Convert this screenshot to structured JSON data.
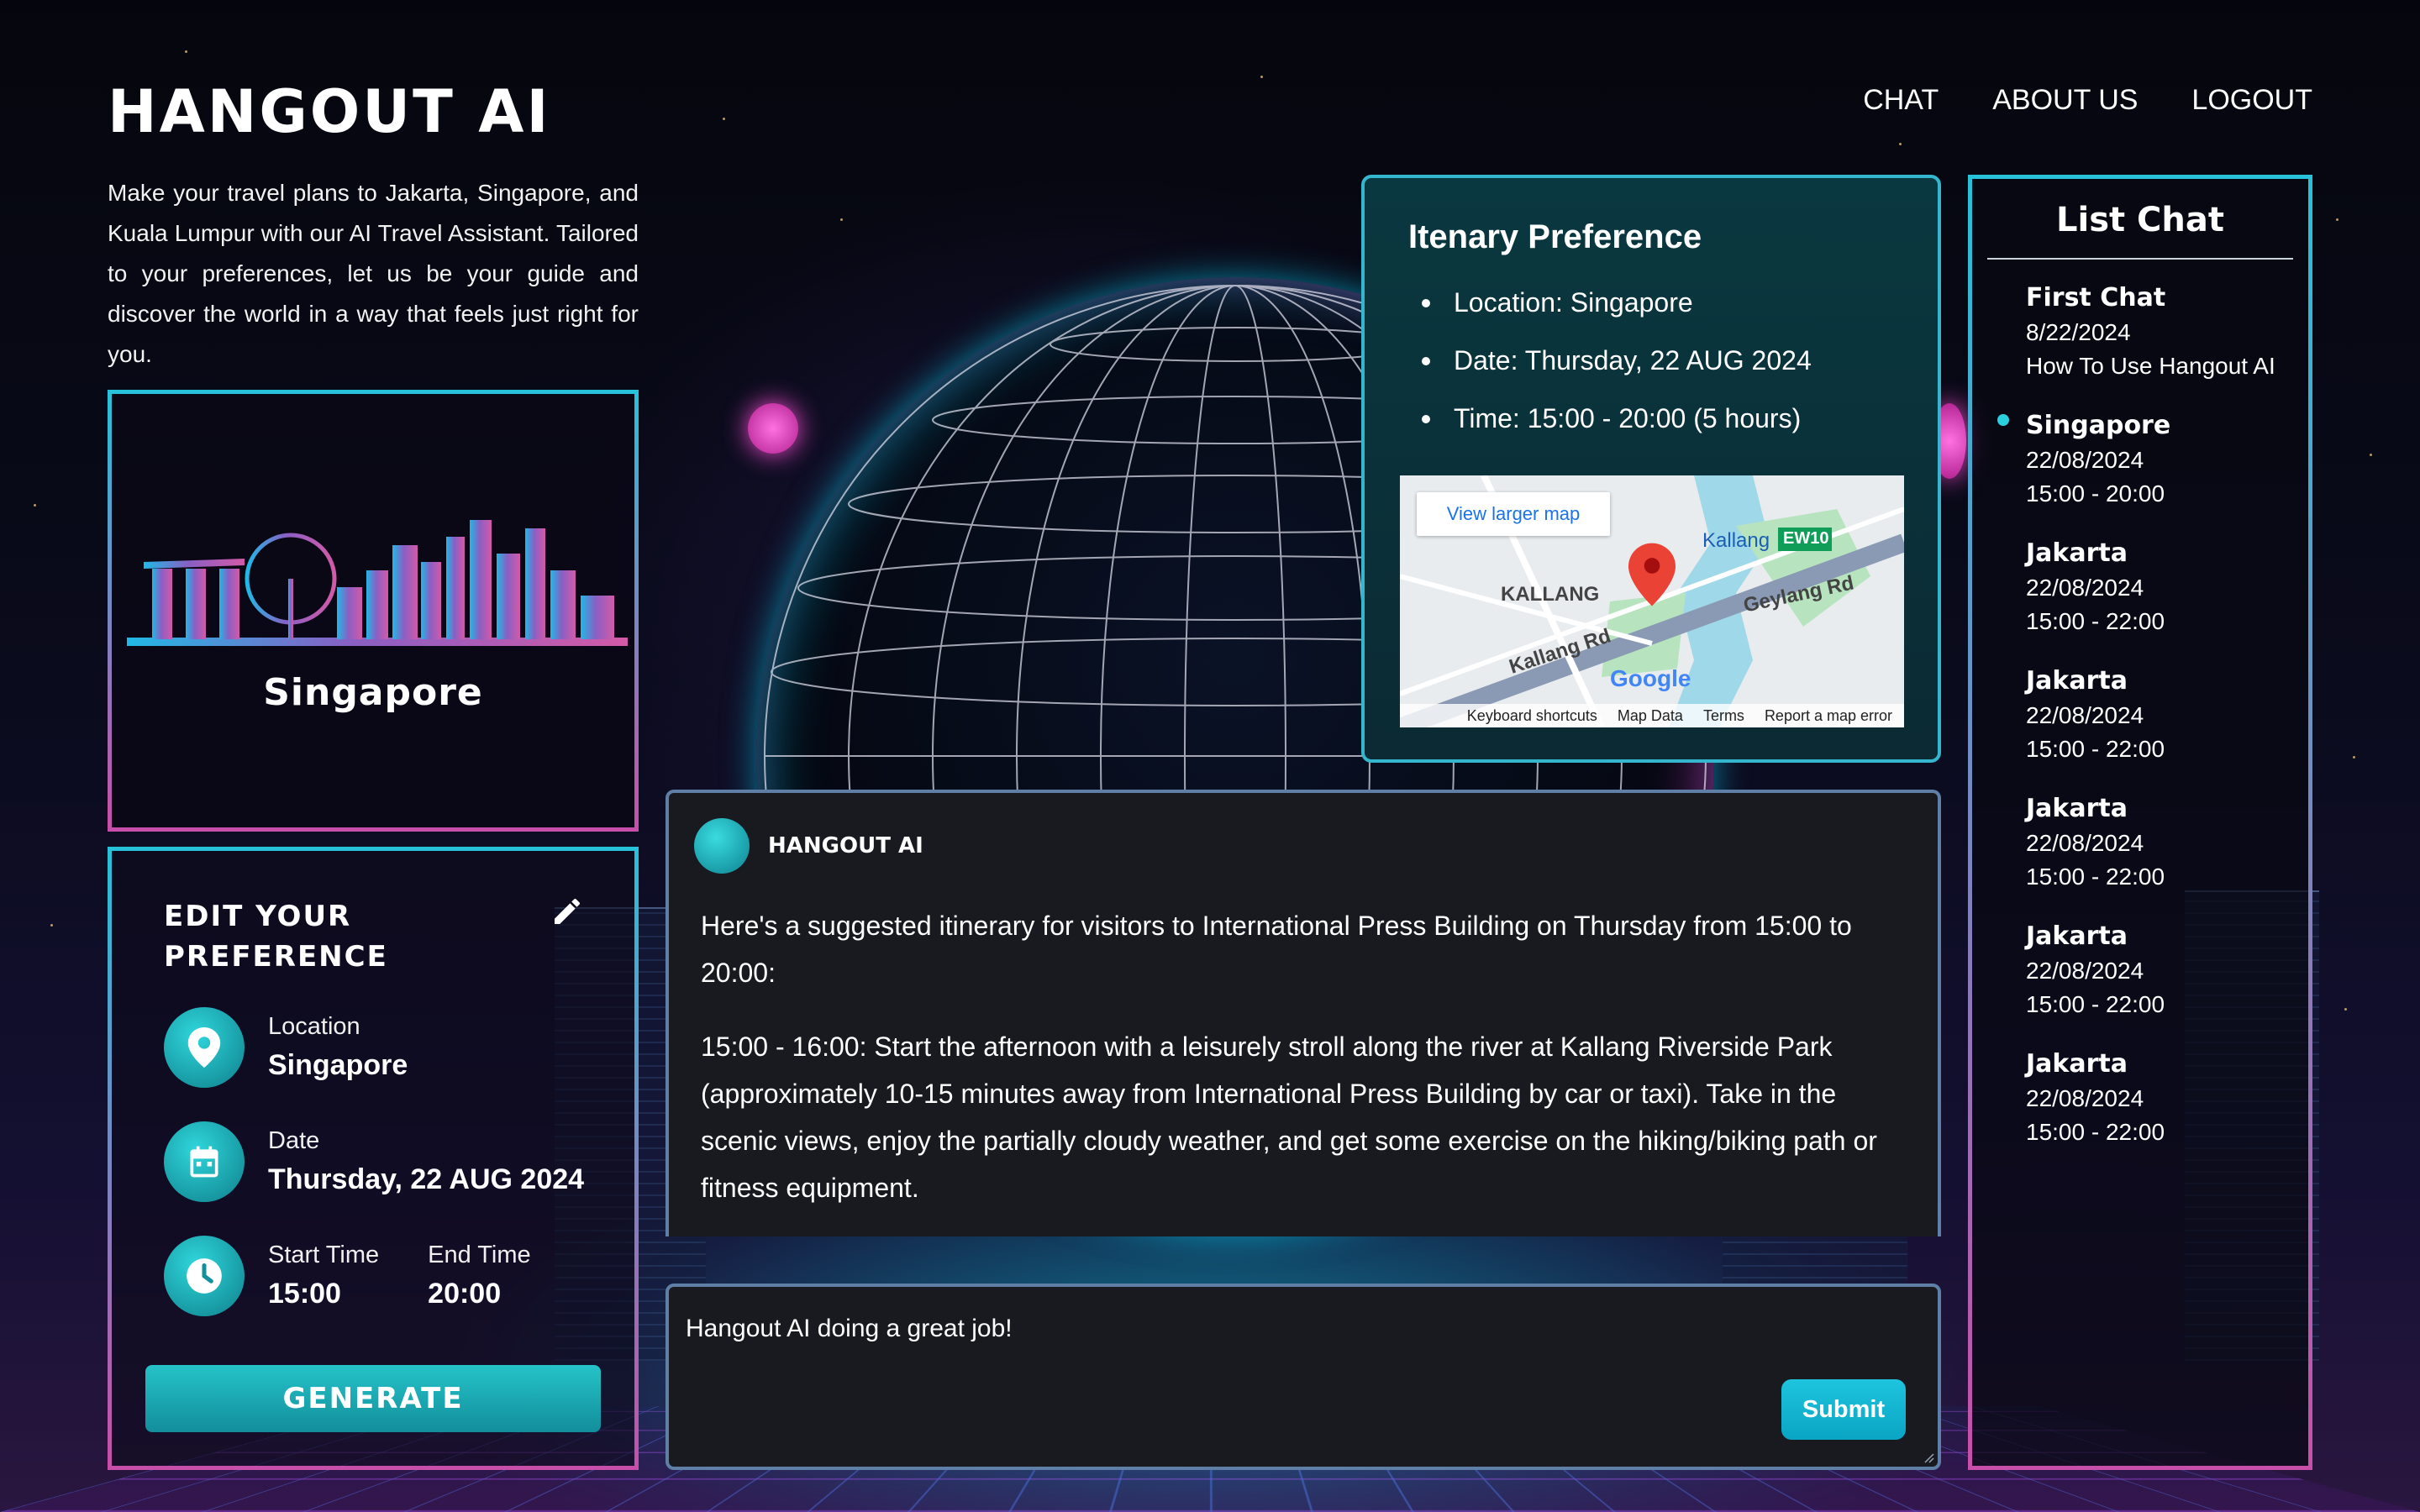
{
  "header": {
    "brand": "HANGOUT AI",
    "nav": [
      "CHAT",
      "ABOUT US",
      "LOGOUT"
    ],
    "intro": "Make your travel plans to Jakarta, Singapore, and Kuala Lumpur with our AI Travel Assistant. Tailored to your preferences, let us be your guide and discover the world in a way that feels just right for you."
  },
  "city_card": {
    "name": "Singapore"
  },
  "preference": {
    "title": "EDIT YOUR PREFERENCE",
    "location_label": "Location",
    "location_value": "Singapore",
    "date_label": "Date",
    "date_value": "Thursday, 22 AUG 2024",
    "start_label": "Start Time",
    "start_value": "15:00",
    "end_label": "End Time",
    "end_value": "20:00",
    "generate_label": "GENERATE"
  },
  "itinerary": {
    "title": "Itenary Preference",
    "items": [
      "Location: Singapore",
      "Date: Thursday, 22 AUG 2024",
      "Time: 15:00 - 20:00 (5 hours)"
    ],
    "map": {
      "view_larger": "View larger map",
      "labels": [
        "KALLANG",
        "Kallang",
        "EW10",
        "Geylang Rd",
        "Kallang Rd",
        "Google"
      ],
      "footer": [
        "Keyboard shortcuts",
        "Map Data",
        "Terms",
        "Report a map error"
      ]
    }
  },
  "chat": {
    "sender": "HANGOUT AI",
    "messages": [
      "Here's a suggested itinerary for visitors to International Press Building on Thursday from 15:00 to 20:00:",
      "15:00 - 16:00: Start the afternoon with a leisurely stroll along the river at Kallang Riverside Park (approximately 10-15 minutes away from International Press Building by car or taxi). Take in the scenic views, enjoy the partially cloudy weather, and get some exercise on the hiking/biking path or fitness equipment."
    ],
    "input_value": "Hangout AI doing a great job!",
    "submit_label": "Submit"
  },
  "list_chat": {
    "title": "List Chat",
    "items": [
      {
        "name": "First Chat",
        "line1": "8/22/2024",
        "line2": "How To Use Hangout AI"
      },
      {
        "name": "Singapore",
        "line1": "22/08/2024",
        "line2": "15:00 - 20:00"
      },
      {
        "name": "Jakarta",
        "line1": "22/08/2024",
        "line2": "15:00 - 22:00"
      },
      {
        "name": "Jakarta",
        "line1": "22/08/2024",
        "line2": "15:00 - 22:00"
      },
      {
        "name": "Jakarta",
        "line1": "22/08/2024",
        "line2": "15:00 - 22:00"
      },
      {
        "name": "Jakarta",
        "line1": "22/08/2024",
        "line2": "15:00 - 22:00"
      },
      {
        "name": "Jakarta",
        "line1": "22/08/2024",
        "line2": "15:00 - 22:00"
      }
    ]
  },
  "colors": {
    "accent_teal": "#27c1d9",
    "accent_pink": "#c84fa9",
    "panel_dark": "#181a20",
    "itinerary_bg": "#0a3840"
  },
  "icons": [
    "pencil-icon",
    "location-pin-icon",
    "calendar-icon",
    "clock-icon",
    "map-marker-icon"
  ]
}
